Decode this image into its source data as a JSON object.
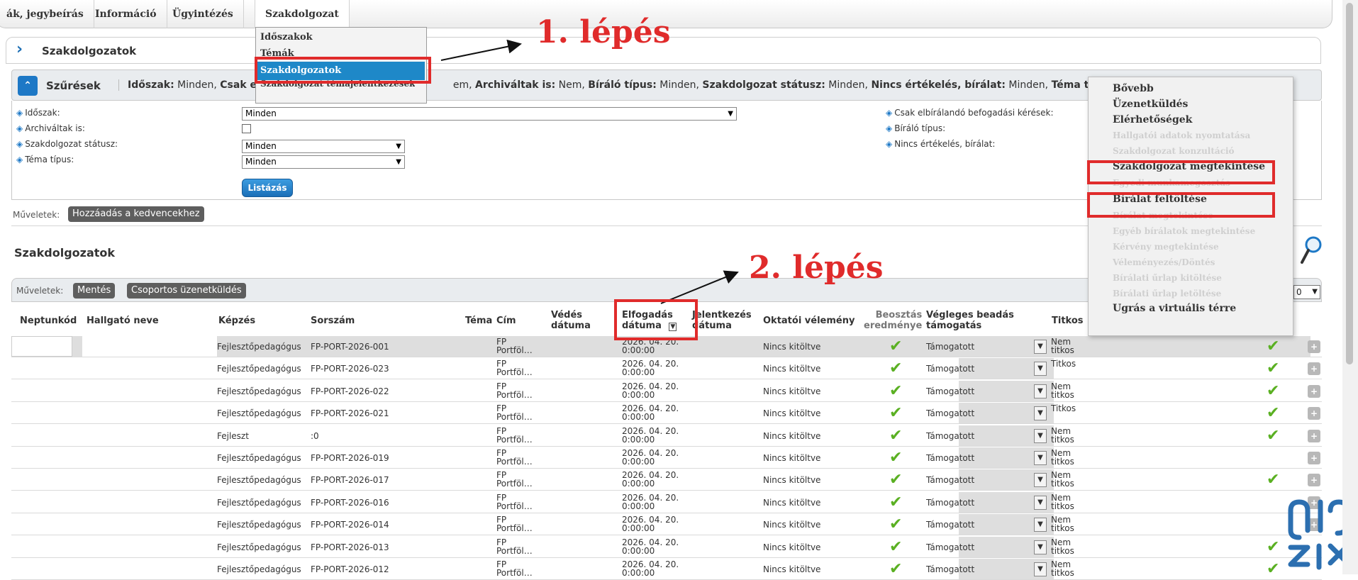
{
  "topnav": {
    "items": [
      "ák, jegybeírás",
      "Információ",
      "Ügyintézés",
      "Szakdolgozat"
    ]
  },
  "dropdown": {
    "items": [
      "Időszakok",
      "Témák",
      "Szakdolgozatok",
      "Szakdolgozat témajelentkezések"
    ]
  },
  "annotations": {
    "step1": "1. lépés",
    "step2": "2. lépés"
  },
  "panel": {
    "title": "Szakdolgozatok"
  },
  "filters": {
    "label": "Szűrések",
    "summary": [
      {
        "k": "Időszak:",
        "v": " Minden, "
      },
      {
        "k": "Csak elb",
        "v": ""
      },
      {
        "k": "",
        "v": "em, "
      },
      {
        "k": "Archiváltak is:",
        "v": " Nem, "
      },
      {
        "k": "Bíráló típus:",
        "v": " Minden, "
      },
      {
        "k": "Szakdolgozat státusz:",
        "v": " Minden, "
      },
      {
        "k": "Nincs értékelés, bírálat:",
        "v": " Minden, "
      },
      {
        "k": "Téma típus",
        "v": ""
      }
    ],
    "form": {
      "idoszak_label": "Időszak:",
      "idoszak_value": "Minden",
      "archivaltak_label": "Archiváltak is:",
      "statusz_label": "Szakdolgozat státusz:",
      "statusz_value": "Minden",
      "tematipus_label": "Téma típus:",
      "tematipus_value": "Minden",
      "csak_label": "Csak elbírálandó befogadási kérések:",
      "biralo_label": "Bíráló típus:",
      "nincs_label": "Nincs értékelés, bírálat:",
      "list_button": "Listázás"
    }
  },
  "actions": {
    "label": "Műveletek:",
    "favorite": "Hozzáadás a kedvencekhez"
  },
  "grid": {
    "title": "Szakdolgozatok",
    "actions_label": "Műveletek:",
    "save": "Mentés",
    "group_message": "Csoportos üzenetküldés",
    "page_size": "0",
    "columns": {
      "neptun": "Neptunkód",
      "name": "Hallgató neve",
      "kepzes": "Képzés",
      "sorszam": "Sorszám",
      "tema": "Téma",
      "cim": "Cím",
      "vedes1": "Védés",
      "vedes2": "dátuma",
      "elf1": "Elfogadás",
      "elf2": "dátuma",
      "jel1": "Jelentkezés",
      "jel2": "dátuma",
      "okt": "Oktatói vélemény",
      "beo1": "Beosztás",
      "beo2": "eredménye",
      "veg1": "Végleges beadás",
      "veg2": "támogatás",
      "titkos": "Titkos"
    },
    "rows": [
      {
        "kepzes": "Fejlesztőpedagógus",
        "sorszam": "FP-PORT-2026-001",
        "cim1": "FP",
        "cim2": "Portföl…",
        "d1": "2026. 04. 20.",
        "d2": "0:00:00",
        "okt": "Nincs kitöltve",
        "veg": "Támogatott",
        "t1": "Nem",
        "t2": "titkos",
        "check": true
      },
      {
        "kepzes": "Fejlesztőpedagógus",
        "sorszam": "FP-PORT-2026-023",
        "cim1": "FP",
        "cim2": "Portföl…",
        "d1": "2026. 04. 20.",
        "d2": "0:00:00",
        "okt": "Nincs kitöltve",
        "veg": "Támogatott",
        "t1": "Titkos",
        "t2": "",
        "check": true
      },
      {
        "kepzes": "Fejlesztőpedagógus",
        "sorszam": "FP-PORT-2026-022",
        "cim1": "FP",
        "cim2": "Portföl…",
        "d1": "2026. 04. 20.",
        "d2": "0:00:00",
        "okt": "Nincs kitöltve",
        "veg": "Támogatott",
        "t1": "Nem",
        "t2": "titkos",
        "check": true
      },
      {
        "kepzes": "Fejlesztőpedagógus",
        "sorszam": "FP-PORT-2026-021",
        "cim1": "FP",
        "cim2": "Portföl…",
        "d1": "2026. 04. 20.",
        "d2": "0:00:00",
        "okt": "Nincs kitöltve",
        "veg": "Támogatott",
        "t1": "Titkos",
        "t2": "",
        "check": true
      },
      {
        "kepzes": "Fejleszt",
        "sorszam": ":0",
        "cim1": "FP",
        "cim2": "Portföl…",
        "d1": "2026. 04. 20.",
        "d2": "0:00:00",
        "okt": "Nincs kitöltve",
        "veg": "Támogatott",
        "t1": "Nem",
        "t2": "titkos",
        "check": true
      },
      {
        "kepzes": "Fejlesztőpedagógus",
        "sorszam": "FP-PORT-2026-019",
        "cim1": "FP",
        "cim2": "Portföl…",
        "d1": "2026. 04. 20.",
        "d2": "0:00:00",
        "okt": "Nincs kitöltve",
        "veg": "Támogatott",
        "t1": "Nem",
        "t2": "titkos",
        "check": false
      },
      {
        "kepzes": "Fejlesztőpedagógus",
        "sorszam": "FP-PORT-2026-017",
        "cim1": "FP",
        "cim2": "Portföl…",
        "d1": "2026. 04. 20.",
        "d2": "0:00:00",
        "okt": "Nincs kitöltve",
        "veg": "Támogatott",
        "t1": "Nem",
        "t2": "titkos",
        "check": true
      },
      {
        "kepzes": "Fejlesztőpedagógus",
        "sorszam": "FP-PORT-2026-016",
        "cim1": "FP",
        "cim2": "Portföl…",
        "d1": "2026. 04. 20.",
        "d2": "0:00:00",
        "okt": "Nincs kitöltve",
        "veg": "Támogatott",
        "t1": "Nem",
        "t2": "titkos",
        "check": false
      },
      {
        "kepzes": "Fejlesztőpedagógus",
        "sorszam": "FP-PORT-2026-014",
        "cim1": "FP",
        "cim2": "Portföl…",
        "d1": "2026. 04. 20.",
        "d2": "0:00:00",
        "okt": "Nincs kitöltve",
        "veg": "Támogatott",
        "t1": "Nem",
        "t2": "titkos",
        "check": false
      },
      {
        "kepzes": "Fejlesztőpedagógus",
        "sorszam": "FP-PORT-2026-013",
        "cim1": "FP",
        "cim2": "Portföl…",
        "d1": "2026. 04. 20.",
        "d2": "0:00:00",
        "okt": "Nincs kitöltve",
        "veg": "Támogatott",
        "t1": "Nem",
        "t2": "titkos",
        "check": true
      },
      {
        "kepzes": "Fejlesztőpedagógus",
        "sorszam": "FP-PORT-2026-012",
        "cim1": "FP",
        "cim2": "Portföl…",
        "d1": "2026. 04. 20.",
        "d2": "0:00:00",
        "okt": "Nincs kitöltve",
        "veg": "Támogatott",
        "t1": "Nem",
        "t2": "titkos",
        "check": true
      }
    ]
  },
  "context_menu": {
    "items": [
      {
        "label": "Bővebb",
        "enabled": true
      },
      {
        "label": "Üzenetküldés",
        "enabled": true
      },
      {
        "label": "Elérhetőségek",
        "enabled": true
      },
      {
        "label": "Hallgatói adatok nyomtatása",
        "enabled": false
      },
      {
        "label": "Szakdolgozat konzultáció",
        "enabled": false
      },
      {
        "label": "Szakdolgozat megtekintése",
        "enabled": true
      },
      {
        "label": "Egyedi munkamegosztás",
        "enabled": false
      },
      {
        "label": "Bírálat feltöltése",
        "enabled": true
      },
      {
        "label": "Bírálat megtekintése",
        "enabled": false
      },
      {
        "label": "Egyéb bírálatok megtekintése",
        "enabled": false
      },
      {
        "label": "Kérvény megtekintése",
        "enabled": false
      },
      {
        "label": "Véleményezés/Döntés",
        "enabled": false
      },
      {
        "label": "Bírálati űrlap kitöltése",
        "enabled": false
      },
      {
        "label": "Bírálati űrlap letöltése",
        "enabled": false
      },
      {
        "label": "Ugrás a virtuális térre",
        "enabled": true
      }
    ]
  },
  "colors": {
    "accent": "#1d78c6",
    "highlight": "#e02b2b",
    "check": "#5ab022",
    "selected_menu": "#1e88c8"
  }
}
